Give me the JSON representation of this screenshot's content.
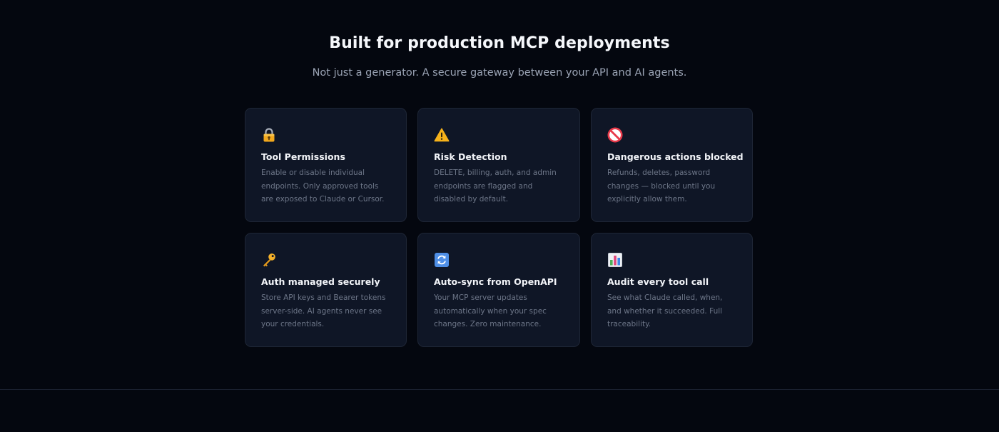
{
  "section": {
    "title": "Built for production MCP deployments",
    "subtitle": "Not just a generator. A secure gateway between your API and AI agents."
  },
  "features": [
    {
      "icon": "lock-icon",
      "title": "Tool Permissions",
      "description": "Enable or disable individual endpoints. Only approved tools are exposed to Claude or Cursor."
    },
    {
      "icon": "warning-icon",
      "title": "Risk Detection",
      "description": "DELETE, billing, auth, and admin endpoints are flagged and disabled by default."
    },
    {
      "icon": "no-entry-icon",
      "title": "Dangerous actions blocked",
      "description": "Refunds, deletes, password changes — blocked until you explicitly allow them."
    },
    {
      "icon": "key-icon",
      "title": "Auth managed securely",
      "description": "Store API keys and Bearer tokens server-side. AI agents never see your credentials."
    },
    {
      "icon": "sync-icon",
      "title": "Auto-sync from OpenAPI",
      "description": "Your MCP server updates automatically when your spec changes. Zero maintenance."
    },
    {
      "icon": "bar-chart-icon",
      "title": "Audit every tool call",
      "description": "See what Claude called, when, and whether it succeeded. Full traceability."
    }
  ],
  "colors": {
    "background": "#04070f",
    "card_background": "#0f1626",
    "card_border": "#1e2636",
    "title_text": "#f5f7fb",
    "muted_text": "#6d7688"
  }
}
